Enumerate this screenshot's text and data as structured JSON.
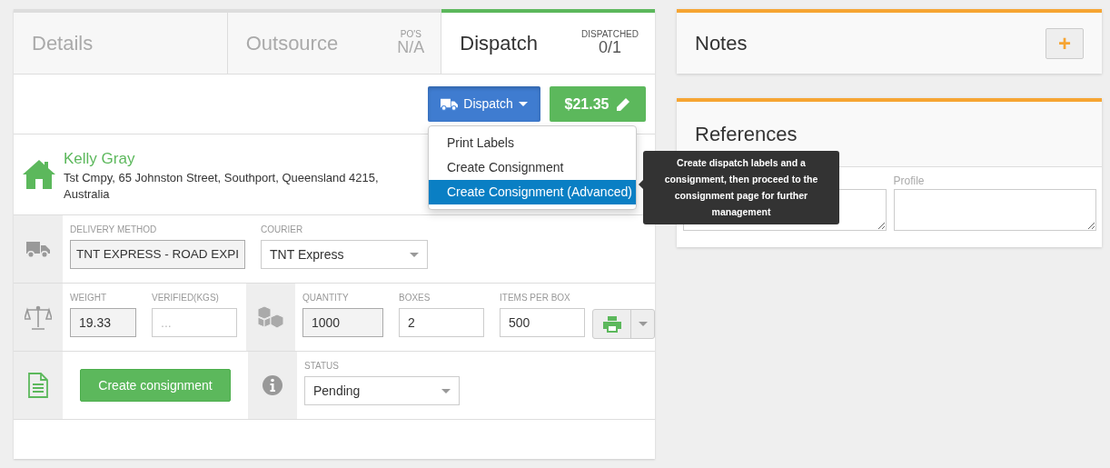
{
  "tabs": [
    {
      "label": "Details",
      "selected": false
    },
    {
      "label": "Outsource",
      "selected": false,
      "stat_label": "PO'S",
      "stat_value": "N/A"
    },
    {
      "label": "Dispatch",
      "selected": true,
      "stat_label": "DISPATCHED",
      "stat_value": "0/1"
    }
  ],
  "dispatch_button": {
    "label": "Dispatch",
    "expanded": true
  },
  "price_button": {
    "label": "$21.35"
  },
  "dropdown": [
    {
      "label": "Print Labels",
      "selected": false
    },
    {
      "label": "Create Consignment",
      "selected": false
    },
    {
      "label": "Create Consignment (Advanced)",
      "selected": true
    }
  ],
  "tooltip": "Create dispatch labels and a consignment, then proceed to the consignment page for further management",
  "customer": {
    "name": "Kelly Gray",
    "address": "Tst Cmpy, 65 Johnston Street, Southport, Queensland 4215, Australia"
  },
  "delivery_fields": [
    {
      "label": "DELIVERY METHOD",
      "kind": "readonly",
      "value": "TNT EXPRESS - ROAD EXPI"
    },
    {
      "label": "COURIER",
      "kind": "select",
      "value": "TNT Express"
    }
  ],
  "weight_fields": [
    {
      "label": "WEIGHT",
      "kind": "readonly",
      "value": "19.33"
    },
    {
      "label": "VERIFIED(KGS)",
      "kind": "input",
      "placeholder": "..."
    }
  ],
  "quantity_fields": [
    {
      "label": "QUANTITY",
      "kind": "readonly",
      "value": "1000"
    },
    {
      "label": "BOXES",
      "kind": "input",
      "value": "2"
    },
    {
      "label": "ITEMS PER BOX",
      "kind": "input",
      "value": "500"
    }
  ],
  "create_button": {
    "label": "Create consignment"
  },
  "status_field": {
    "label": "STATUS",
    "kind": "select",
    "value": "Pending"
  },
  "notes": {
    "title": "Notes",
    "add_label": "+"
  },
  "references": {
    "title": "References",
    "fields": [
      {
        "kind": "textarea"
      },
      {
        "kind": "textarea",
        "label": "Profile"
      }
    ]
  }
}
